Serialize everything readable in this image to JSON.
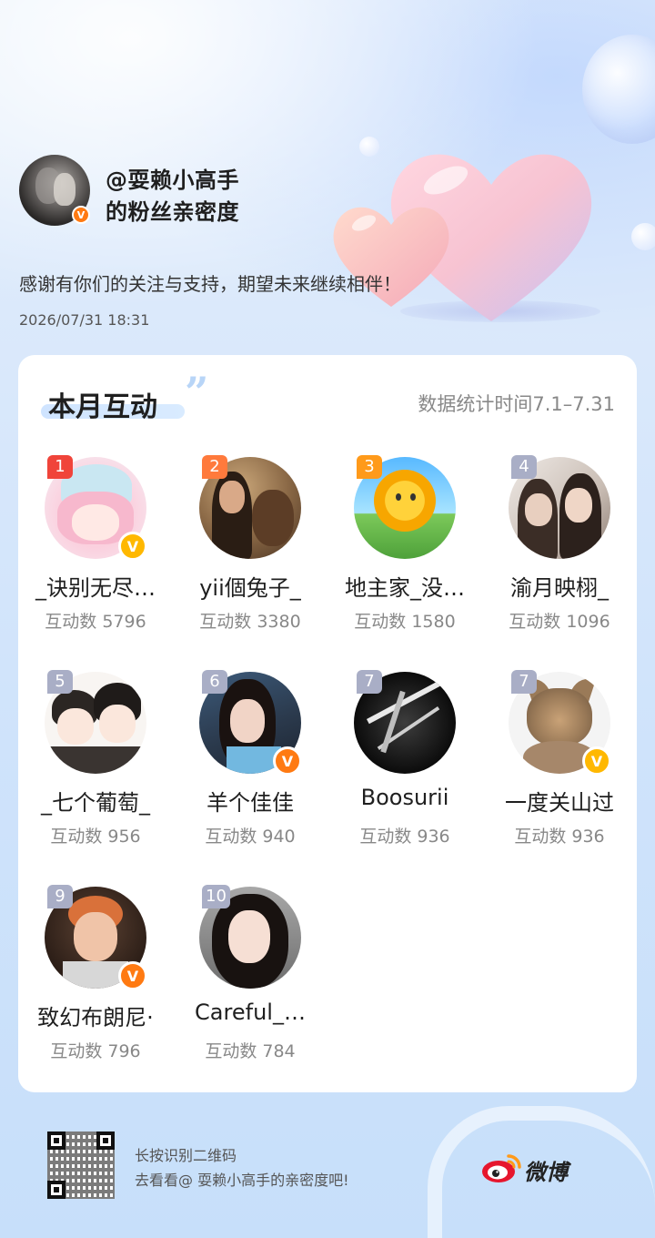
{
  "header": {
    "username_line": "@耍赖小高手",
    "subtitle_line": "的粉丝亲密度",
    "thanks": "感谢有你们的关注与支持，期望未来继续相伴！",
    "datetime": "2026/07/31 18:31",
    "verified_badge": "V"
  },
  "card": {
    "title": "本月互动",
    "quote_mark": "”",
    "stat_time": "数据统计时间7.1–7.31",
    "fans": [
      {
        "rank": "1",
        "nickname": "_诀别无尽…",
        "count": "互动数 5796",
        "badge": "V"
      },
      {
        "rank": "2",
        "nickname": "yii個兔子_",
        "count": "互动数 3380"
      },
      {
        "rank": "3",
        "nickname": "地主家_没…",
        "count": "互动数 1580"
      },
      {
        "rank": "4",
        "nickname": "渝月映栩_",
        "count": "互动数 1096"
      },
      {
        "rank": "5",
        "nickname": "_七个葡萄_",
        "count": "互动数 956"
      },
      {
        "rank": "6",
        "nickname": "羊个佳佳",
        "count": "互动数 940",
        "badge": "V"
      },
      {
        "rank": "7",
        "nickname": "Boosurii",
        "count": "互动数 936"
      },
      {
        "rank": "7",
        "nickname": "一度关山过",
        "count": "互动数 936",
        "badge": "V"
      },
      {
        "rank": "9",
        "nickname": "致幻布朗尼·",
        "count": "互动数 796",
        "badge": "V"
      },
      {
        "rank": "10",
        "nickname": "Careful_…",
        "count": "互动数 784"
      }
    ]
  },
  "footer": {
    "line1": "长按识别二维码",
    "line2": "去看看@ 耍赖小高手的亲密度吧!",
    "brand": "微博"
  },
  "colors": {
    "rank1": "#f0443a",
    "rank2": "#ff7a3c",
    "rank3": "#ff9a1a",
    "rank_other": "#a9aec6",
    "badge_orange": "#ff7a12",
    "badge_gold": "#ffb800",
    "weibo_red": "#e6162d"
  }
}
